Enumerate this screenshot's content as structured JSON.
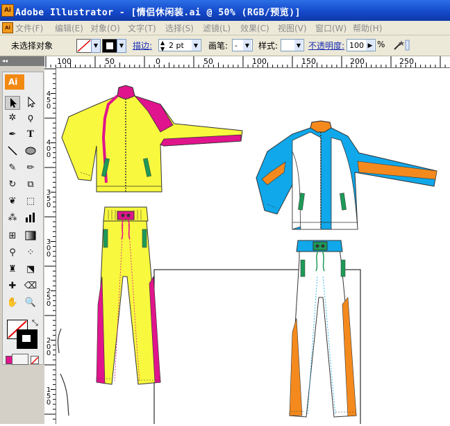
{
  "window": {
    "title": "Adobe Illustrator - [情侣休闲装.ai @ 50% (RGB/预览)]",
    "app_icon": "Ai"
  },
  "menu": {
    "doc_icon": "Ai",
    "items": [
      {
        "label": "文件(F)"
      },
      {
        "label": "编辑(E)"
      },
      {
        "label": "对象(O)"
      },
      {
        "label": "文字(T)"
      },
      {
        "label": "选择(S)"
      },
      {
        "label": "滤镜(L)"
      },
      {
        "label": "效果(C)"
      },
      {
        "label": "视图(V)"
      },
      {
        "label": "窗口(W)"
      },
      {
        "label": "帮助(H)"
      }
    ]
  },
  "control_bar": {
    "selection_status": "未选择对象",
    "stroke_label": "描边:",
    "stroke_weight": "2 pt",
    "brush_label": "画笔:",
    "brush_value": "-",
    "style_label": "样式:",
    "opacity_label": "不透明度:",
    "opacity_value": "100",
    "opacity_unit": "%"
  },
  "toolbox": {
    "logo": "Ai",
    "grip": "◂◂"
  },
  "rulers": {
    "horizontal": [
      "100",
      "50",
      "0",
      "50",
      "100",
      "150",
      "200",
      "250"
    ],
    "vertical": [
      "450",
      "400",
      "350",
      "300",
      "250",
      "200",
      "150"
    ]
  },
  "colors": {
    "title_bar": "#1447c8",
    "menu_bg": "#ece9d8",
    "jacket_yellow": "#f8f83e",
    "accent_magenta": "#e0148c",
    "jacket_blue": "#10a8ea",
    "accent_orange": "#f48a1e",
    "accent_green": "#1e9a58"
  }
}
